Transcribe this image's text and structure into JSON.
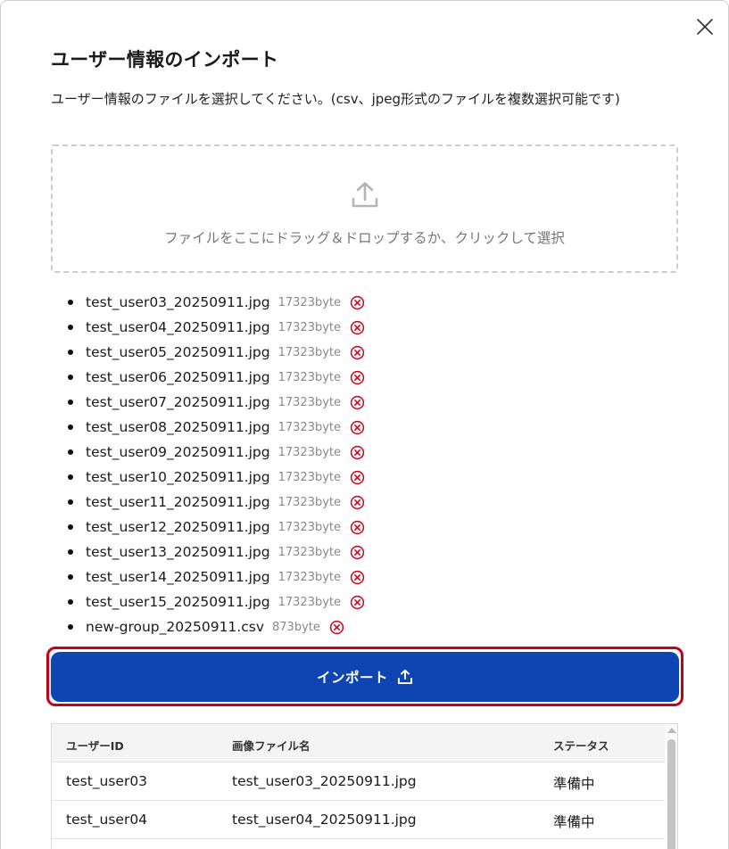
{
  "dialog": {
    "title": "ユーザー情報のインポート",
    "description": "ユーザー情報のファイルを選択してください。(csv、jpeg形式のファイルを複数選択可能です)"
  },
  "dropzone": {
    "text": "ファイルをここにドラッグ＆ドロップするか、クリックして選択"
  },
  "files": [
    {
      "name": "test_user03_20250911.jpg",
      "size": "17323byte"
    },
    {
      "name": "test_user04_20250911.jpg",
      "size": "17323byte"
    },
    {
      "name": "test_user05_20250911.jpg",
      "size": "17323byte"
    },
    {
      "name": "test_user06_20250911.jpg",
      "size": "17323byte"
    },
    {
      "name": "test_user07_20250911.jpg",
      "size": "17323byte"
    },
    {
      "name": "test_user08_20250911.jpg",
      "size": "17323byte"
    },
    {
      "name": "test_user09_20250911.jpg",
      "size": "17323byte"
    },
    {
      "name": "test_user10_20250911.jpg",
      "size": "17323byte"
    },
    {
      "name": "test_user11_20250911.jpg",
      "size": "17323byte"
    },
    {
      "name": "test_user12_20250911.jpg",
      "size": "17323byte"
    },
    {
      "name": "test_user13_20250911.jpg",
      "size": "17323byte"
    },
    {
      "name": "test_user14_20250911.jpg",
      "size": "17323byte"
    },
    {
      "name": "test_user15_20250911.jpg",
      "size": "17323byte"
    },
    {
      "name": "new-group_20250911.csv",
      "size": "873byte"
    }
  ],
  "import_button": {
    "label": "インポート"
  },
  "table": {
    "headers": [
      "ユーザーID",
      "画像ファイル名",
      "ステータス"
    ],
    "rows": [
      [
        "test_user03",
        "test_user03_20250911.jpg",
        "準備中"
      ],
      [
        "test_user04",
        "test_user04_20250911.jpg",
        "準備中"
      ],
      [
        "",
        "",
        ""
      ]
    ]
  },
  "icons": {
    "close": "close-icon",
    "upload": "upload-icon",
    "remove": "remove-circle-icon",
    "import": "upload-icon"
  },
  "colors": {
    "primary": "#0f44b3",
    "highlight_outline": "#c4001a",
    "remove_icon": "#d0021b"
  }
}
